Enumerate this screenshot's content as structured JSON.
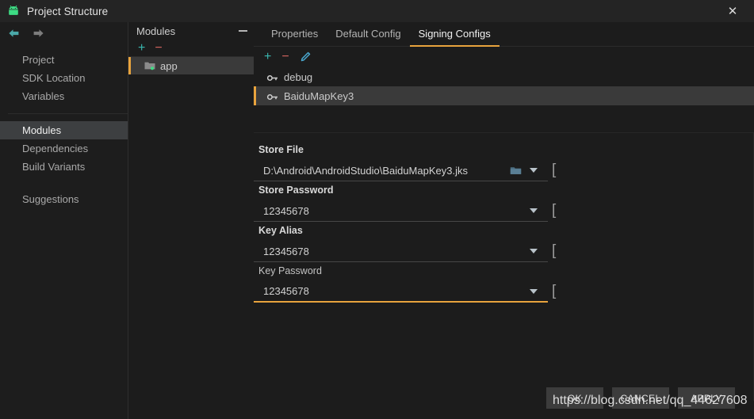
{
  "window": {
    "title": "Project Structure",
    "app_icon": "android-icon",
    "close_label": "✕"
  },
  "sidebar": {
    "back_icon": "back-arrow-icon",
    "forward_icon": "forward-arrow-icon",
    "items": [
      {
        "label": "Project",
        "selected": false
      },
      {
        "label": "SDK Location",
        "selected": false
      },
      {
        "label": "Variables",
        "selected": false
      },
      {
        "label": "Modules",
        "selected": true
      },
      {
        "label": "Dependencies",
        "selected": false
      },
      {
        "label": "Build Variants",
        "selected": false
      },
      {
        "label": "Suggestions",
        "selected": false
      }
    ]
  },
  "modules_panel": {
    "title": "Modules",
    "minimize_icon": "minimize-icon",
    "toolbar": {
      "add_label": "+",
      "remove_label": "−"
    },
    "module": {
      "name": "app",
      "icon": "folder-icon"
    }
  },
  "main": {
    "tabs": [
      {
        "label": "Properties",
        "active": false
      },
      {
        "label": "Default Config",
        "active": false
      },
      {
        "label": "Signing Configs",
        "active": true
      }
    ],
    "toolbar": {
      "add_label": "+",
      "remove_label": "−",
      "edit_icon": "pencil-icon"
    },
    "signing_configs": [
      {
        "name": "debug",
        "icon": "key-icon",
        "selected": false
      },
      {
        "name": "BaiduMapKey3",
        "icon": "key-icon",
        "selected": true
      }
    ],
    "fields": [
      {
        "label": "Store File",
        "value": "D:\\Android\\AndroidStudio\\BaiduMapKey3.jks",
        "placeholder": "",
        "has_browse": true,
        "browse_icon": "folder-icon",
        "dropdown_icon": "chevron-down-icon",
        "focused": false,
        "bold_label": true
      },
      {
        "label": "Store Password",
        "value": "12345678",
        "placeholder": "",
        "has_browse": false,
        "dropdown_icon": "chevron-down-icon",
        "focused": false,
        "bold_label": true
      },
      {
        "label": "Key Alias",
        "value": "12345678",
        "placeholder": "",
        "has_browse": false,
        "dropdown_icon": "chevron-down-icon",
        "focused": false,
        "bold_label": true
      },
      {
        "label": "Key Password",
        "value": "12345678",
        "placeholder": "",
        "has_browse": false,
        "dropdown_icon": "chevron-down-icon",
        "focused": true,
        "bold_label": false
      }
    ]
  },
  "footer": {
    "buttons": [
      {
        "label": "OK",
        "name": "ok-button"
      },
      {
        "label": "CANCEL",
        "name": "cancel-button"
      },
      {
        "label": "APPLY",
        "name": "apply-button"
      }
    ]
  },
  "watermark": {
    "text": "https://blog.csdn.net/qq_44627608"
  },
  "colors": {
    "accent_orange": "#e8a33d",
    "teal": "#3ab8b0",
    "red": "#d4655f",
    "android_green": "#3ddc84",
    "window_bg": "#1c1c1c",
    "titlebar_bg": "#242424",
    "selection_bg": "#3a3a3a"
  }
}
